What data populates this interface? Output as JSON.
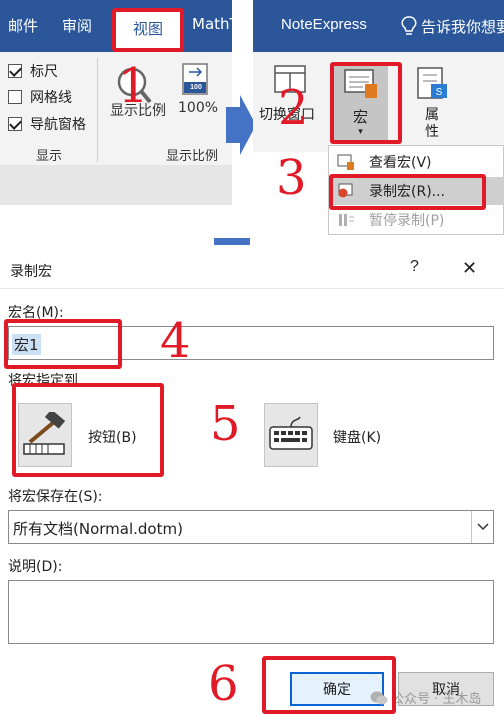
{
  "ribbon_left": {
    "tabs": [
      "邮件",
      "审阅",
      "视图",
      "MathT"
    ],
    "active_tab": "视图",
    "show_group": {
      "items": [
        {
          "label": "标尺",
          "checked": true
        },
        {
          "label": "网格线",
          "checked": false
        },
        {
          "label": "导航窗格",
          "checked": true
        }
      ],
      "label": "显示"
    },
    "zoom_group": {
      "zoom_label": "显示比例",
      "hundred_label": "100%",
      "hundred_badge": "100",
      "label": "显示比例"
    }
  },
  "ribbon_right": {
    "tab_noteexpress": "NoteExpress",
    "tell_me": "告诉我你想要",
    "switch_window": "切换窗口",
    "macro": "宏",
    "properties": "属\n性",
    "menu": [
      {
        "label": "查看宏(V)",
        "enabled": true
      },
      {
        "label": "录制宏(R)...",
        "enabled": true
      },
      {
        "label": "暂停录制(P)",
        "enabled": false
      }
    ]
  },
  "dialog": {
    "title": "录制宏",
    "help": "?",
    "close": "✕",
    "macro_name_label": "宏名(M):",
    "macro_name_value": "宏1",
    "assign_label": "将宏指定到",
    "button_label": "按钮(B)",
    "keyboard_label": "键盘(K)",
    "store_label": "将宏保存在(S):",
    "store_value": "所有文档(Normal.dotm)",
    "desc_label": "说明(D):",
    "desc_value": "",
    "ok": "确定",
    "cancel": "取消"
  },
  "annotations": {
    "steps": [
      "1",
      "2",
      "3",
      "4",
      "5",
      "6"
    ],
    "watermark": "公众号 · 王木岛"
  },
  "colors": {
    "ribbon_blue": "#2b579a",
    "annotation_red": "#e11a27",
    "arrow_blue": "#4472c4"
  }
}
